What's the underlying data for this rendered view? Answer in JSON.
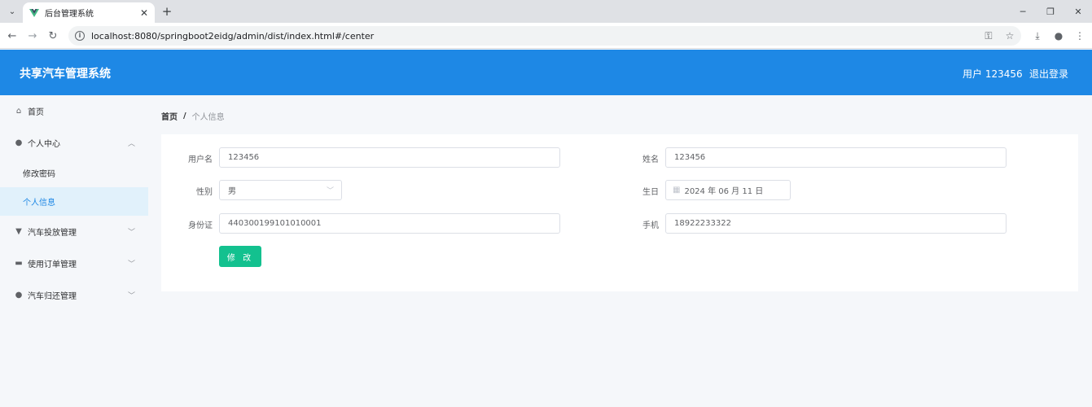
{
  "browser": {
    "tab_title": "后台管理系统",
    "url": "localhost:8080/springboot2eidg/admin/dist/index.html#/center"
  },
  "header": {
    "title": "共享汽车管理系统",
    "user": "用户 123456",
    "logout": "退出登录"
  },
  "sidebar": {
    "items": [
      {
        "label": "首页",
        "icon": "home-icon"
      },
      {
        "label": "个人中心",
        "icon": "user-icon",
        "children": [
          "修改密码",
          "个人信息"
        ],
        "active_child": "个人信息"
      },
      {
        "label": "汽车投放管理",
        "icon": "car-icon"
      },
      {
        "label": "使用订单管理",
        "icon": "monitor-icon"
      },
      {
        "label": "汽车归还管理",
        "icon": "user-icon"
      }
    ]
  },
  "breadcrumb": {
    "home": "首页",
    "separator": "/",
    "current": "个人信息"
  },
  "form": {
    "username_label": "用户名",
    "username_value": "123456",
    "name_label": "姓名",
    "name_value": "123456",
    "gender_label": "性别",
    "gender_value": "男",
    "birthday_label": "生日",
    "birthday_value": "2024 年 06 月 11 日",
    "idcard_label": "身份证",
    "idcard_value": "440300199101010001",
    "phone_label": "手机",
    "phone_value": "18922233322",
    "submit_label": "修 改"
  },
  "colors": {
    "header_bg": "#1e88e5",
    "submit_bg": "#13c18f",
    "active_sub_bg": "#e1f1fb"
  }
}
